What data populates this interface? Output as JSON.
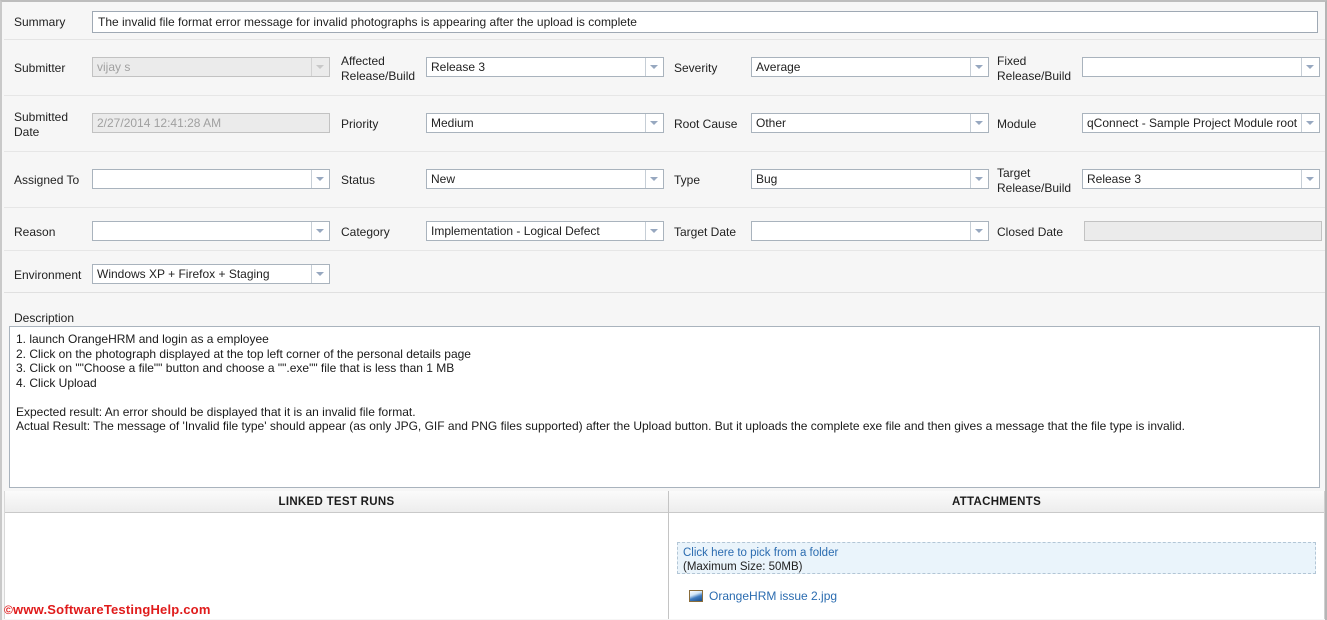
{
  "summary": {
    "label": "Summary",
    "value": "The invalid file format error message for invalid photographs is appearing after the upload is complete"
  },
  "fields": {
    "submitter": {
      "label": "Submitter",
      "value": "vijay s",
      "disabled": true
    },
    "affected_release": {
      "label_line1": "Affected",
      "label_line2": "Release/Build",
      "value": "Release 3"
    },
    "severity": {
      "label": "Severity",
      "value": "Average"
    },
    "fixed_release": {
      "label_line1": "Fixed",
      "label_line2": "Release/Build",
      "value": ""
    },
    "submitted_date": {
      "label_line1": "Submitted",
      "label_line2": "Date",
      "value": "2/27/2014 12:41:28 AM",
      "disabled": true
    },
    "priority": {
      "label": "Priority",
      "value": "Medium"
    },
    "root_cause": {
      "label": "Root Cause",
      "value": "Other"
    },
    "module": {
      "label": "Module",
      "value": "qConnect - Sample Project Module root"
    },
    "assigned_to": {
      "label": "Assigned To",
      "value": ""
    },
    "status": {
      "label": "Status",
      "value": "New"
    },
    "type": {
      "label": "Type",
      "value": "Bug"
    },
    "target_release": {
      "label_line1": "Target",
      "label_line2": "Release/Build",
      "value": "Release 3"
    },
    "reason": {
      "label": "Reason",
      "value": ""
    },
    "category": {
      "label": "Category",
      "value": "Implementation - Logical Defect"
    },
    "target_date": {
      "label": "Target Date",
      "value": ""
    },
    "closed_date": {
      "label": "Closed Date",
      "value": "",
      "disabled": true
    },
    "environment": {
      "label": "Environment",
      "value": "Windows XP + Firefox + Staging"
    }
  },
  "description": {
    "label": "Description",
    "value": "1. launch OrangeHRM and login as a employee\n2. Click on the photograph displayed at the top left corner of the personal details page\n3. Click on \"\"Choose a file\"\" button and choose a \"\".exe\"\" file that is less than 1 MB\n4. Click Upload\n\nExpected result: An error should be displayed that it is an invalid file format.\nActual Result: The message of 'Invalid file type' should appear (as only JPG, GIF and PNG files supported) after the Upload button. But it uploads the complete exe file and then gives a message that the file type is invalid."
  },
  "panels": {
    "linked_test_runs": {
      "title": "LINKED TEST RUNS"
    },
    "attachments": {
      "title": "ATTACHMENTS",
      "dropzone_link": "Click here to pick from a folder",
      "dropzone_note": "(Maximum Size: 50MB)",
      "items": [
        {
          "icon": "image-file-icon",
          "name": "OrangeHRM issue 2.jpg"
        }
      ]
    }
  },
  "watermark": {
    "copyright": "©",
    "text": "www.SoftwareTestingHelp.com"
  }
}
